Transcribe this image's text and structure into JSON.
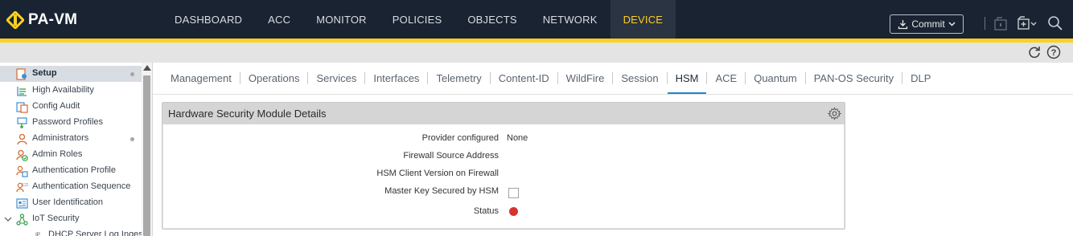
{
  "app": {
    "name": "PA-VM",
    "accent_color": "#fbd023",
    "topbar_color": "#192331"
  },
  "nav": {
    "items": [
      {
        "label": "DASHBOARD"
      },
      {
        "label": "ACC"
      },
      {
        "label": "MONITOR"
      },
      {
        "label": "POLICIES"
      },
      {
        "label": "OBJECTS"
      },
      {
        "label": "NETWORK"
      },
      {
        "label": "DEVICE",
        "active": true
      }
    ],
    "commit_label": "Commit",
    "icons": [
      "commit-icon",
      "lock-icon",
      "config-icon",
      "search-icon"
    ]
  },
  "toolbar": {
    "icons": [
      "refresh-icon",
      "help-icon"
    ]
  },
  "sidebar": {
    "items": [
      {
        "label": "Setup",
        "icon": "setup-icon",
        "selected": true,
        "dot": true
      },
      {
        "label": "High Availability",
        "icon": "ha-icon"
      },
      {
        "label": "Config Audit",
        "icon": "audit-icon"
      },
      {
        "label": "Password Profiles",
        "icon": "password-icon"
      },
      {
        "label": "Administrators",
        "icon": "admin-icon",
        "dot": true
      },
      {
        "label": "Admin Roles",
        "icon": "admin-roles-icon"
      },
      {
        "label": "Authentication Profile",
        "icon": "auth-profile-icon"
      },
      {
        "label": "Authentication Sequence",
        "icon": "auth-sequence-icon"
      },
      {
        "label": "User Identification",
        "icon": "user-id-icon"
      },
      {
        "label": "IoT Security",
        "icon": "iot-icon",
        "expanded": true
      },
      {
        "label": "DHCP Server Log Ingestion",
        "icon": "dhcp-icon",
        "child": true
      }
    ]
  },
  "tabs": {
    "items": [
      {
        "label": "Management"
      },
      {
        "label": "Operations"
      },
      {
        "label": "Services"
      },
      {
        "label": "Interfaces"
      },
      {
        "label": "Telemetry"
      },
      {
        "label": "Content-ID"
      },
      {
        "label": "WildFire"
      },
      {
        "label": "Session"
      },
      {
        "label": "HSM",
        "active": true
      },
      {
        "label": "ACE"
      },
      {
        "label": "Quantum"
      },
      {
        "label": "PAN-OS Security"
      },
      {
        "label": "DLP"
      }
    ]
  },
  "panel": {
    "title": "Hardware Security Module Details",
    "fields": [
      {
        "label": "Provider configured",
        "value": "None"
      },
      {
        "label": "Firewall Source Address",
        "value": ""
      },
      {
        "label": "HSM Client Version on Firewall",
        "value": ""
      },
      {
        "label": "Master Key Secured by HSM",
        "checked": false
      },
      {
        "label": "Status",
        "status_color": "#d73232"
      }
    ]
  }
}
